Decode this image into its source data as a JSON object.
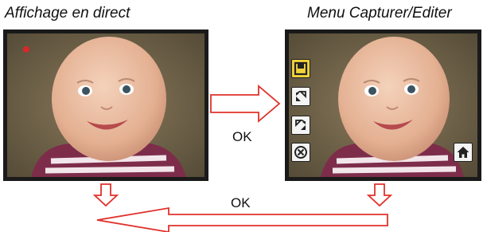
{
  "captions": {
    "live_view": "Affichage en direct",
    "capture_edit_menu": "Menu Capturer/Editer"
  },
  "transitions": {
    "ok_top": "OK",
    "ok_bottom": "OK"
  },
  "menu_icons": [
    "save-icon",
    "rotate-left-icon",
    "rotate-right-icon",
    "cancel-icon",
    "home-icon"
  ],
  "colors": {
    "arrow_outline": "#e0322b",
    "selected_button": "#f2d23a",
    "recording_dot": "#d8282a",
    "screen_frame": "#1a1a1a"
  }
}
